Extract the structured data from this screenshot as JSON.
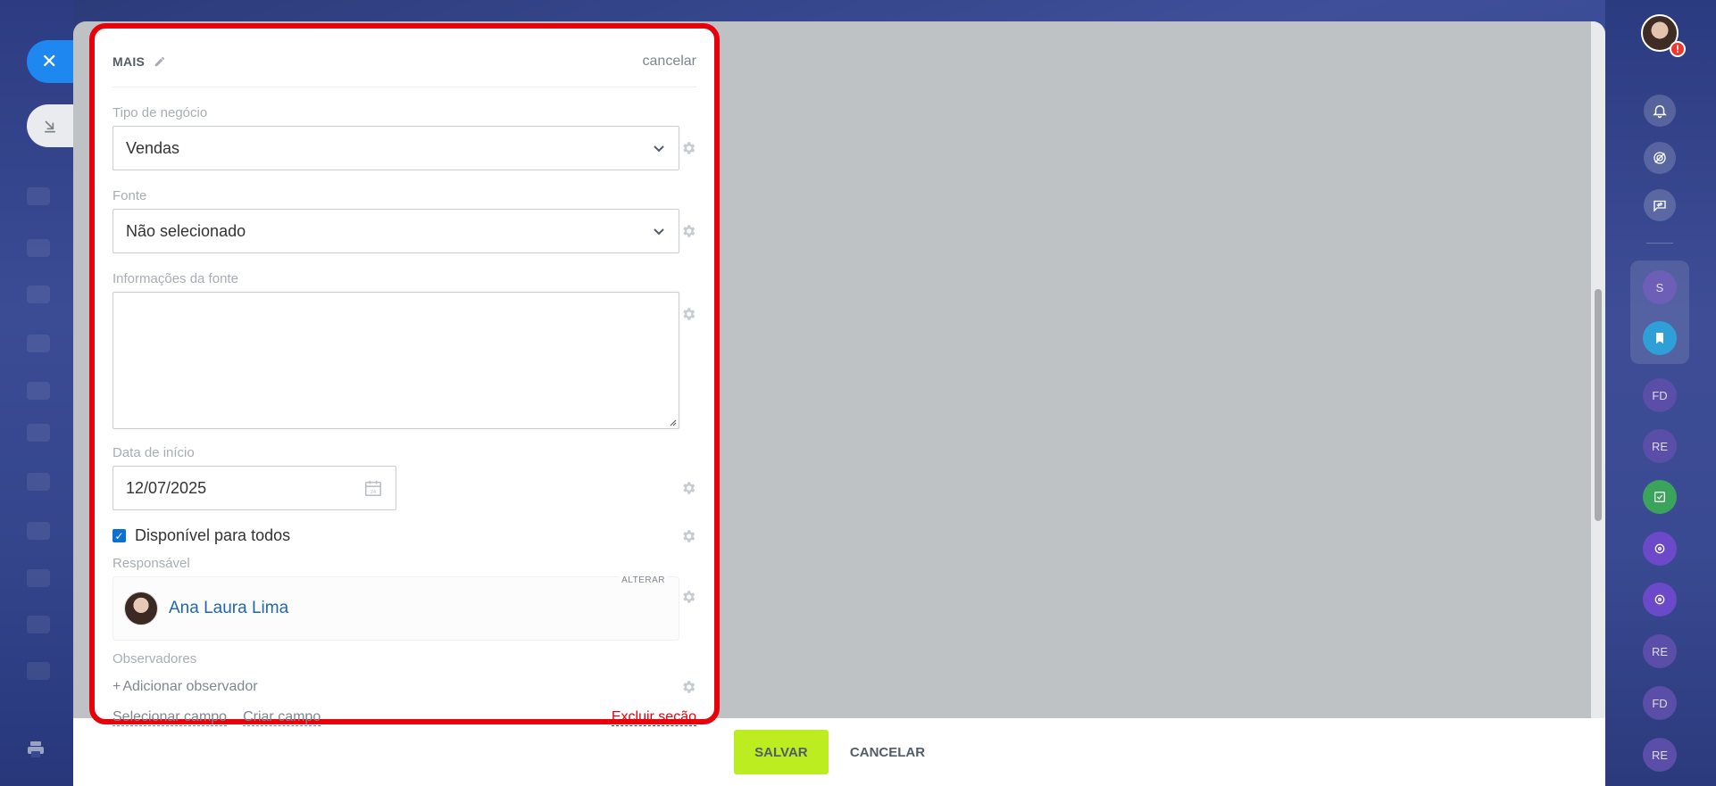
{
  "form": {
    "section_title": "MAIS",
    "cancel_link": "cancelar",
    "fields": {
      "deal_type": {
        "label": "Tipo de negócio",
        "value": "Vendas"
      },
      "source": {
        "label": "Fonte",
        "value": "Não selecionado"
      },
      "source_info": {
        "label": "Informações da fonte",
        "value": ""
      },
      "start_date": {
        "label": "Data de início",
        "value": "12/07/2025"
      },
      "available_to_all": {
        "label": "Disponível para todos",
        "checked": true
      },
      "responsible": {
        "label": "Responsável",
        "change_label": "ALTERAR",
        "name": "Ana Laura Lima"
      },
      "observers": {
        "label": "Observadores",
        "add_label": "Adicionar observador",
        "add_prefix": "+"
      }
    },
    "footer": {
      "select_field": "Selecionar campo",
      "create_field": "Criar campo",
      "delete_section": "Excluir seção"
    }
  },
  "slider_footer": {
    "save_label": "SALVAR",
    "cancel_label": "CANCELAR"
  },
  "right_sidebar": {
    "alert_badge": "!",
    "group_items": [
      {
        "initials": "S",
        "color": "#6d5fb8"
      },
      {
        "icon": "bookmark-icon",
        "color": "#2f9fd8"
      }
    ],
    "items": [
      {
        "initials": "FD",
        "color": "#5a4ea8"
      },
      {
        "initials": "RE",
        "color": "#5a4ea8"
      },
      {
        "icon": "checklist-icon",
        "color": "#3aa55a"
      },
      {
        "icon": "chat-icon",
        "color": "#6c49c8"
      },
      {
        "icon": "chat-icon",
        "color": "#6c49c8"
      },
      {
        "initials": "RE",
        "color": "#5a4ea8"
      },
      {
        "initials": "FD",
        "color": "#5a4ea8"
      },
      {
        "initials": "RE",
        "color": "#5a4ea8"
      }
    ]
  },
  "colors": {
    "accent_blue": "#1e88f0",
    "highlight_red": "#e8000b",
    "save_green": "#bbed21",
    "link_blue": "#2067b0"
  }
}
